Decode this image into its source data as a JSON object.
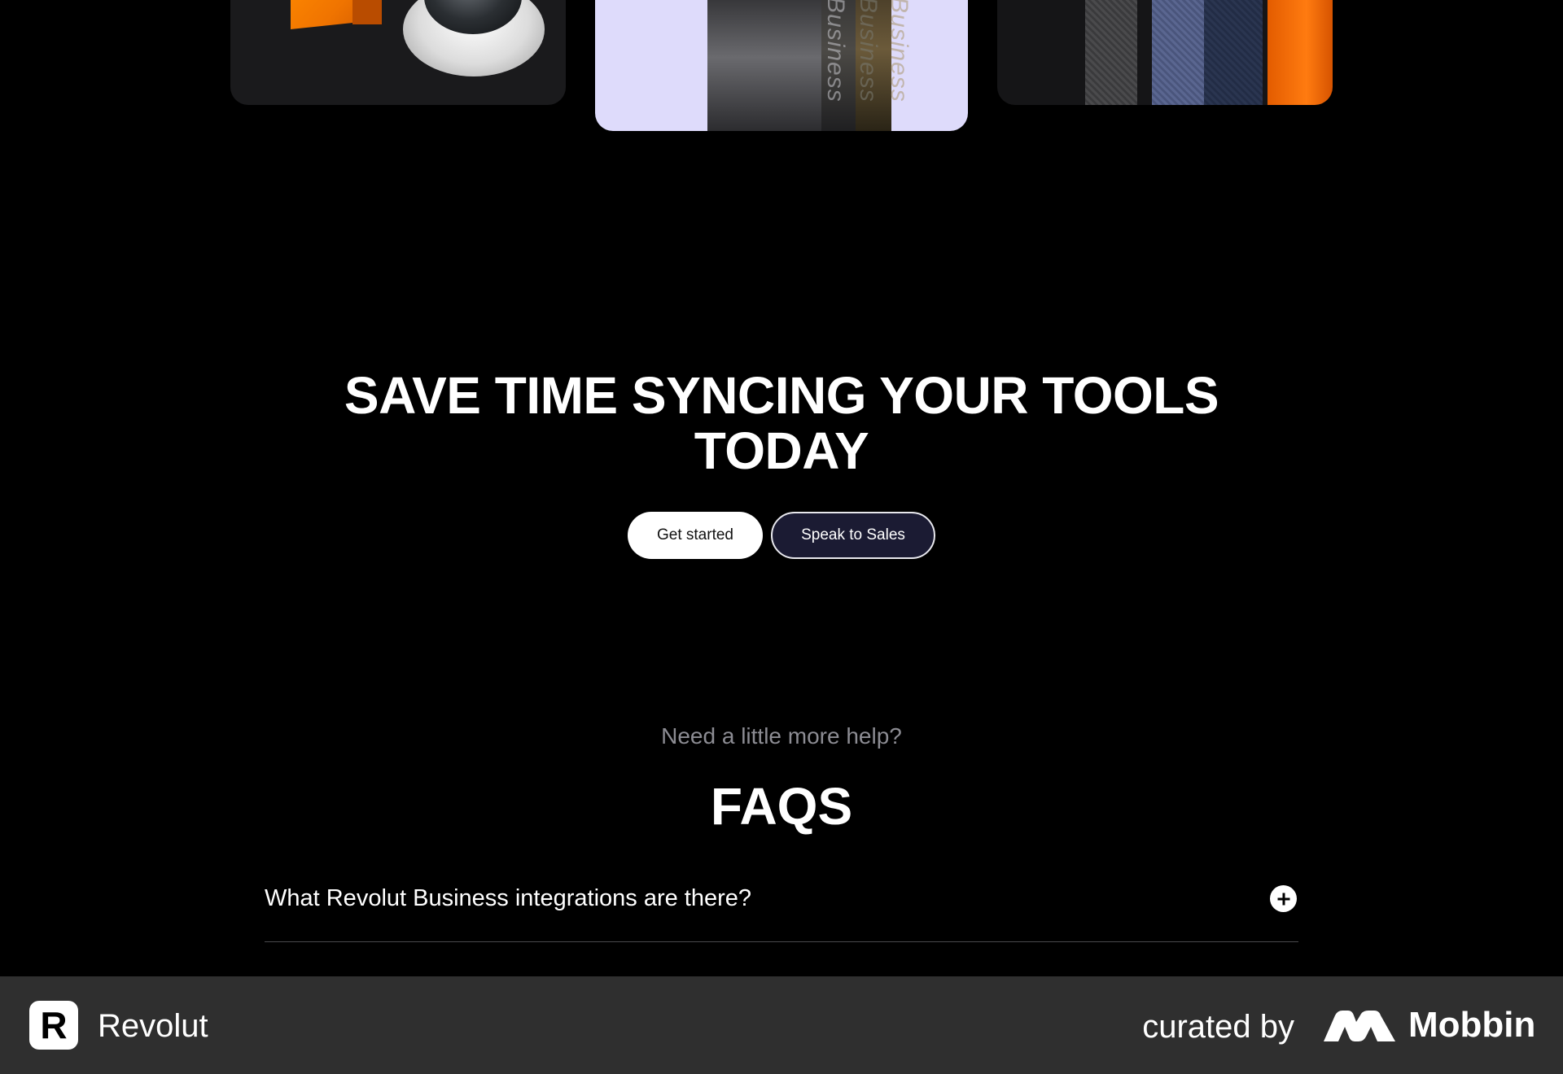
{
  "hero": {
    "title_line1": "SAVE TIME SYNCING YOUR TOOLS",
    "title_line2": "TODAY",
    "primary_button": "Get started",
    "secondary_button": "Speak to Sales"
  },
  "cards": {
    "middle_card_texts": [
      "Business",
      "Business",
      "Business"
    ]
  },
  "faq": {
    "eyebrow": "Need a little more help?",
    "title": "FAQS",
    "items": [
      {
        "question": "What Revolut Business integrations are there?"
      }
    ]
  },
  "footer": {
    "brand_name": "Revolut",
    "brand_glyph": "R",
    "curated_by": "curated by",
    "curator_name": "Mobbin"
  },
  "colors": {
    "background": "#000000",
    "footer_background": "#2f2f2f",
    "secondary_button_fill": "#1b1b33",
    "muted_text": "#8c8c93",
    "card_lavender": "#dedbfb",
    "accent_orange": "#ff7b10"
  },
  "icons": {
    "faq_toggle": "plus-circle-icon",
    "brand_logo": "revolut-logo-icon",
    "curator_logo": "mobbin-logo-icon"
  }
}
